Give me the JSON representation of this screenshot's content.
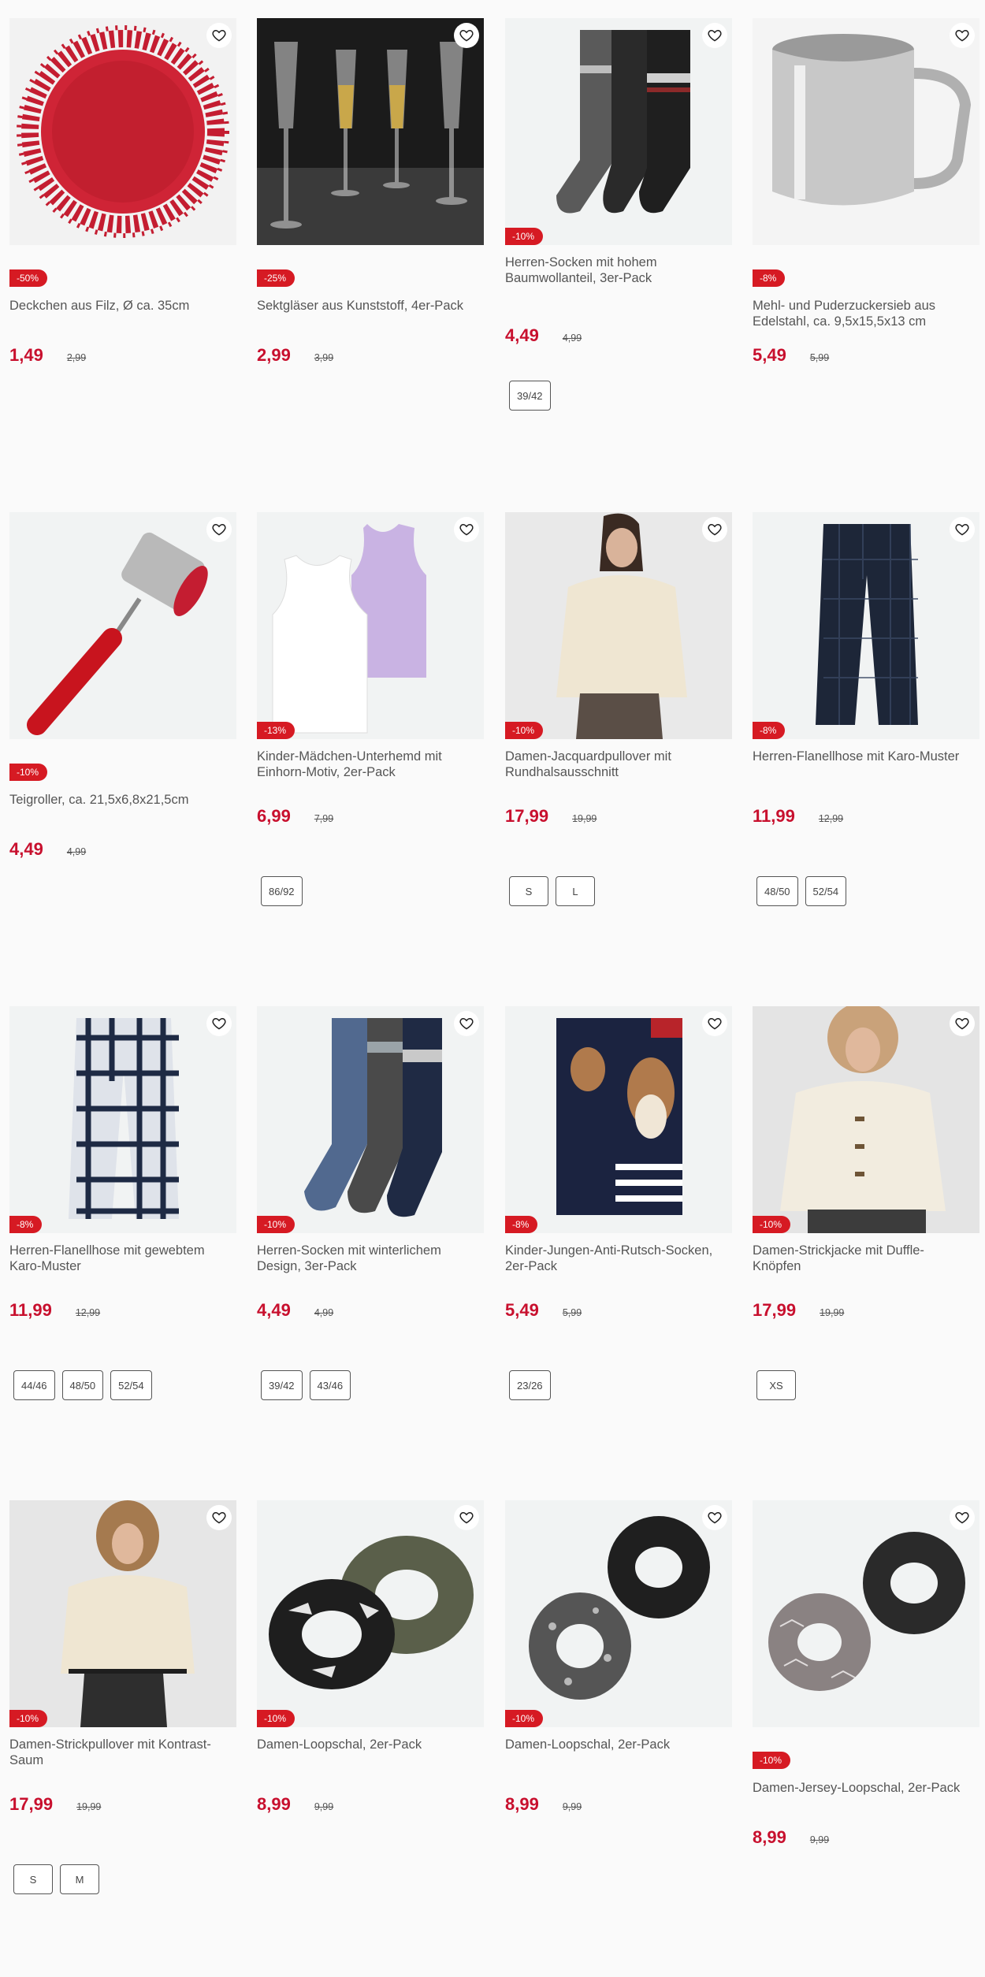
{
  "products": [
    {
      "title": "Deckchen aus Filz, Ø ca. 35cm",
      "badge": "-50%",
      "price": "1,49",
      "old_price": "2,99",
      "sizes": [],
      "icon": "felt-doily-image"
    },
    {
      "title": "Sektgläser aus Kunststoff, 4er-Pack",
      "badge": "-25%",
      "price": "2,99",
      "old_price": "3,99",
      "sizes": [],
      "icon": "champagne-glasses-image"
    },
    {
      "title": "Herren-Socken mit hohem Baumwollanteil, 3er-Pack",
      "badge": "-10%",
      "price": "4,49",
      "old_price": "4,99",
      "sizes": [
        "39/42"
      ],
      "icon": "men-socks-image"
    },
    {
      "title": "Mehl- und Puderzuckersieb aus Edelstahl, ca. 9,5x15,5x13 cm",
      "badge": "-8%",
      "price": "5,49",
      "old_price": "5,99",
      "sizes": [],
      "icon": "flour-sifter-image"
    },
    {
      "title": "Teigroller, ca. 21,5x6,8x21,5cm",
      "badge": "-10%",
      "price": "4,49",
      "old_price": "4,99",
      "sizes": [],
      "icon": "dough-roller-image"
    },
    {
      "title": "Kinder-Mädchen-Unterhemd mit Einhorn-Motiv, 2er-Pack",
      "badge": "-13%",
      "price": "6,99",
      "old_price": "7,99",
      "sizes": [
        "86/92"
      ],
      "icon": "girls-undershirt-image"
    },
    {
      "title": "Damen-Jacquardpullover mit Rundhalsausschnitt",
      "badge": "-10%",
      "price": "17,99",
      "old_price": "19,99",
      "sizes": [
        "S",
        "L"
      ],
      "icon": "women-sweater-image"
    },
    {
      "title": "Herren-Flanellhose mit Karo-Muster",
      "badge": "-8%",
      "price": "11,99",
      "old_price": "12,99",
      "sizes": [
        "48/50",
        "52/54"
      ],
      "icon": "flannel-pants-image"
    },
    {
      "title": "Herren-Flanellhose mit gewebtem Karo-Muster",
      "badge": "-8%",
      "price": "11,99",
      "old_price": "12,99",
      "sizes": [
        "44/46",
        "48/50",
        "52/54"
      ],
      "icon": "checked-pants-image"
    },
    {
      "title": "Herren-Socken mit winterlichem Design, 3er-Pack",
      "badge": "-10%",
      "price": "4,49",
      "old_price": "4,99",
      "sizes": [
        "39/42",
        "43/46"
      ],
      "icon": "winter-socks-image"
    },
    {
      "title": "Kinder-Jungen-Anti-Rutsch-Socken, 2er-Pack",
      "badge": "-8%",
      "price": "5,49",
      "old_price": "5,99",
      "sizes": [
        "23/26"
      ],
      "icon": "kids-socks-image"
    },
    {
      "title": "Damen-Strickjacke mit Duffle-Knöpfen",
      "badge": "-10%",
      "price": "17,99",
      "old_price": "19,99",
      "sizes": [
        "XS"
      ],
      "icon": "women-cardigan-image"
    },
    {
      "title": "Damen-Strickpullover mit Kontrast-Saum",
      "badge": "-10%",
      "price": "17,99",
      "old_price": "19,99",
      "sizes": [
        "S",
        "M"
      ],
      "icon": "women-knit-sweater-image"
    },
    {
      "title": "Damen-Loopschal, 2er-Pack",
      "badge": "-10%",
      "price": "8,99",
      "old_price": "9,99",
      "sizes": [],
      "icon": "loop-scarf-image"
    },
    {
      "title": "Damen-Loopschal, 2er-Pack",
      "badge": "-10%",
      "price": "8,99",
      "old_price": "9,99",
      "sizes": [],
      "icon": "loop-scarf-black-image"
    },
    {
      "title": "Damen-Jersey-Loopschal, 2er-Pack",
      "badge": "-10%",
      "price": "8,99",
      "old_price": "9,99",
      "sizes": [],
      "icon": "jersey-loop-scarf-image"
    }
  ],
  "colors": {
    "accent": "#c8102e",
    "badge": "#d61a23",
    "background": "#fafafa"
  }
}
